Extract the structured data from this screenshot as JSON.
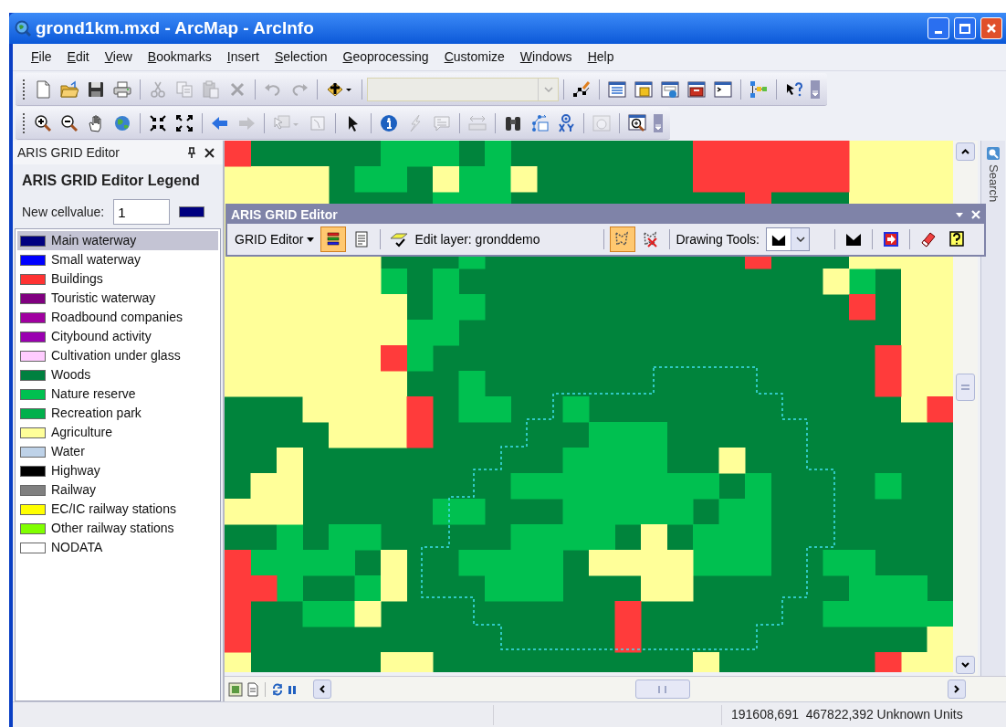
{
  "window": {
    "title": "grond1km.mxd - ArcMap - ArcInfo"
  },
  "menu": [
    {
      "label": "File"
    },
    {
      "label": "Edit"
    },
    {
      "label": "View"
    },
    {
      "label": "Bookmarks"
    },
    {
      "label": "Insert"
    },
    {
      "label": "Selection"
    },
    {
      "label": "Geoprocessing"
    },
    {
      "label": "Customize"
    },
    {
      "label": "Windows"
    },
    {
      "label": "Help"
    }
  ],
  "toolbars": [
    [
      {
        "kind": "new",
        "disabled": false
      },
      {
        "kind": "open",
        "disabled": false
      },
      {
        "kind": "save",
        "disabled": false
      },
      {
        "kind": "print",
        "disabled": false
      },
      {
        "kind": "separator"
      },
      {
        "kind": "cut",
        "disabled": true
      },
      {
        "kind": "copy",
        "disabled": true
      },
      {
        "kind": "paste",
        "disabled": true
      },
      {
        "kind": "delete",
        "disabled": true
      },
      {
        "kind": "separator"
      },
      {
        "kind": "undo",
        "disabled": true
      },
      {
        "kind": "redo",
        "disabled": true
      },
      {
        "kind": "separator"
      },
      {
        "kind": "adddata",
        "disabled": false
      },
      {
        "kind": "separator"
      },
      {
        "kind": "combo",
        "disabled": true
      },
      {
        "kind": "separator"
      },
      {
        "kind": "editor",
        "disabled": false
      },
      {
        "kind": "separator"
      },
      {
        "kind": "table",
        "disabled": false
      },
      {
        "kind": "catalog",
        "disabled": false
      },
      {
        "kind": "search",
        "disabled": false
      },
      {
        "kind": "toolbox",
        "disabled": false
      },
      {
        "kind": "python",
        "disabled": false
      },
      {
        "kind": "separator"
      },
      {
        "kind": "model",
        "disabled": false
      },
      {
        "kind": "separator"
      },
      {
        "kind": "whatsthis",
        "disabled": false
      },
      {
        "kind": "overflow",
        "disabled": false
      }
    ],
    [
      {
        "kind": "zoomin",
        "disabled": false
      },
      {
        "kind": "zoomout",
        "disabled": false
      },
      {
        "kind": "pan",
        "disabled": false
      },
      {
        "kind": "globe",
        "disabled": false
      },
      {
        "kind": "separator"
      },
      {
        "kind": "fixedin",
        "disabled": false
      },
      {
        "kind": "fixedout",
        "disabled": false
      },
      {
        "kind": "separator"
      },
      {
        "kind": "back",
        "disabled": false
      },
      {
        "kind": "forward",
        "disabled": true
      },
      {
        "kind": "separator"
      },
      {
        "kind": "selectfeatures",
        "disabled": true
      },
      {
        "kind": "clearselection",
        "disabled": true
      },
      {
        "kind": "separator"
      },
      {
        "kind": "pointer",
        "disabled": false
      },
      {
        "kind": "separator"
      },
      {
        "kind": "identify",
        "disabled": false
      },
      {
        "kind": "hyperlink",
        "disabled": true
      },
      {
        "kind": "popup",
        "disabled": true
      },
      {
        "kind": "separator"
      },
      {
        "kind": "measure",
        "disabled": true
      },
      {
        "kind": "separator"
      },
      {
        "kind": "find",
        "disabled": false
      },
      {
        "kind": "route",
        "disabled": false
      },
      {
        "kind": "gotoxy",
        "disabled": false
      },
      {
        "kind": "separator"
      },
      {
        "kind": "timeslider",
        "disabled": true
      },
      {
        "kind": "separator"
      },
      {
        "kind": "magnifier",
        "disabled": false
      },
      {
        "kind": "overflow",
        "disabled": false
      }
    ]
  ],
  "panel": {
    "title": "ARIS GRID Editor",
    "heading": "ARIS GRID Editor Legend",
    "cellvalue_label": "New cellvalue:",
    "cellvalue": "1",
    "legend": [
      {
        "label": "Main waterway",
        "color": "#000080",
        "selected": true
      },
      {
        "label": "Small waterway",
        "color": "#0000ff",
        "selected": false
      },
      {
        "label": "Buildings",
        "color": "#ff3333",
        "selected": false
      },
      {
        "label": "Touristic waterway",
        "color": "#800080",
        "selected": false
      },
      {
        "label": "Roadbound companies",
        "color": "#a000a0",
        "selected": false
      },
      {
        "label": "Citybound activity",
        "color": "#9a00b0",
        "selected": false
      },
      {
        "label": "Cultivation under glass",
        "color": "#ffccff",
        "selected": false
      },
      {
        "label": "Woods",
        "color": "#00803f",
        "selected": false
      },
      {
        "label": "Nature reserve",
        "color": "#00c050",
        "selected": false
      },
      {
        "label": "Recreation park",
        "color": "#00b04c",
        "selected": false
      },
      {
        "label": "Agriculture",
        "color": "#ffff99",
        "selected": false
      },
      {
        "label": "Water",
        "color": "#bed2e8",
        "selected": false
      },
      {
        "label": "Highway",
        "color": "#000000",
        "selected": false
      },
      {
        "label": "Railway",
        "color": "#808080",
        "selected": false
      },
      {
        "label": "EC/IC railway stations",
        "color": "#ffff00",
        "selected": false
      },
      {
        "label": "Other railway stations",
        "color": "#80ff00",
        "selected": false
      },
      {
        "label": "NODATA",
        "color": "#ffffff",
        "selected": false
      }
    ]
  },
  "editor_toolbar": {
    "title": "ARIS GRID Editor",
    "menu": "GRID Editor",
    "edit_layer": "Edit layer: gronddemo",
    "drawing_tools_label": "Drawing Tools:",
    "tools": [
      {
        "kind": "legend",
        "active": true
      },
      {
        "kind": "properties",
        "active": false
      },
      {
        "kind": "editlayer",
        "active": false
      },
      {
        "kind": "polygon",
        "active": true
      },
      {
        "kind": "clearpolygon",
        "active": false
      },
      {
        "kind": "drawing",
        "active": false
      },
      {
        "kind": "fill",
        "active": false
      },
      {
        "kind": "export",
        "active": false
      },
      {
        "kind": "eraser",
        "active": false
      },
      {
        "kind": "help",
        "active": false
      }
    ]
  },
  "side_tab": "Search",
  "status_bar": {
    "coordinates": "191608,691  467822,392 Unknown Units"
  }
}
